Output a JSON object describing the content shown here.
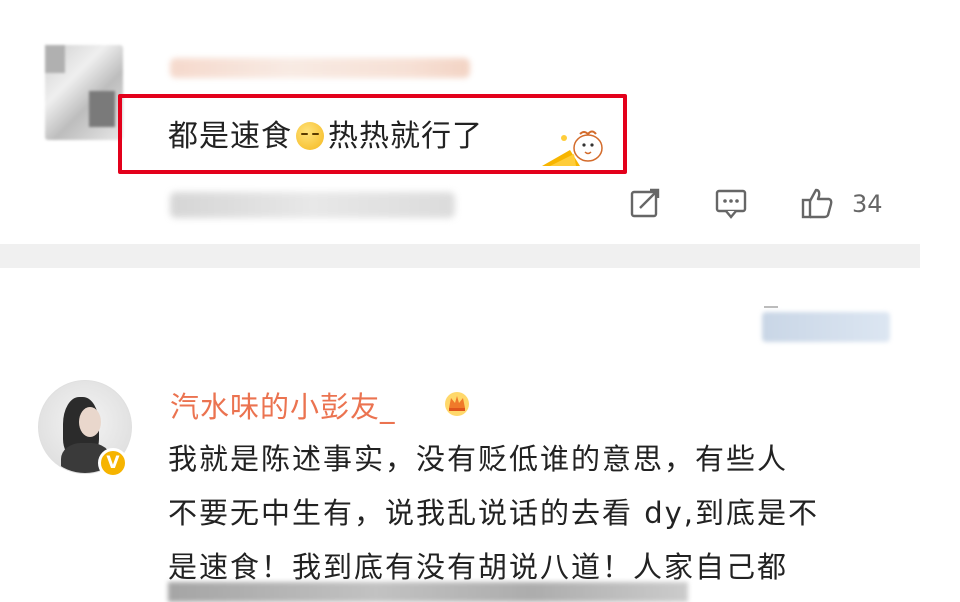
{
  "top_comment": {
    "text_before": "都是速食",
    "emoji": "crying-face-emoji",
    "text_after": "热热就行了",
    "sticker": "chick-sticker",
    "actions": {
      "share_icon": "share-icon",
      "comment_icon": "comment-icon",
      "like_icon": "thumbs-up-icon",
      "like_count": "34"
    },
    "highlight_color": "#e3001b"
  },
  "reply": {
    "username": "汽水味的小彭友_",
    "username_color": "#eb7350",
    "badge_icon": "crown-badge-icon",
    "verified_icon": "verified-v-icon",
    "verified_label": "V",
    "lines": [
      "我就是陈述事实，没有贬低谁的意思，有些人",
      "不要无中生有，说我乱说话的去看 dy,到底是不",
      "是速食！我到底有没有胡说八道！人家自己都"
    ]
  }
}
